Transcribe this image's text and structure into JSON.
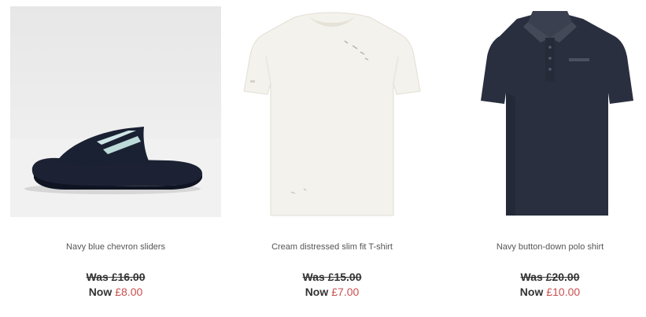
{
  "products": [
    {
      "name": "Navy blue chevron sliders",
      "was_label": "Was",
      "was_price": "£16.00",
      "now_label": "Now",
      "now_price": "£8.00"
    },
    {
      "name": "Cream distressed slim fit T-shirt",
      "was_label": "Was",
      "was_price": "£15.00",
      "now_label": "Now",
      "now_price": "£7.00"
    },
    {
      "name": "Navy button-down polo shirt",
      "was_label": "Was",
      "was_price": "£20.00",
      "now_label": "Now",
      "now_price": "£10.00"
    }
  ],
  "colors": {
    "sale_price": "#c94f4f",
    "text": "#333333",
    "name_text": "#555555"
  }
}
